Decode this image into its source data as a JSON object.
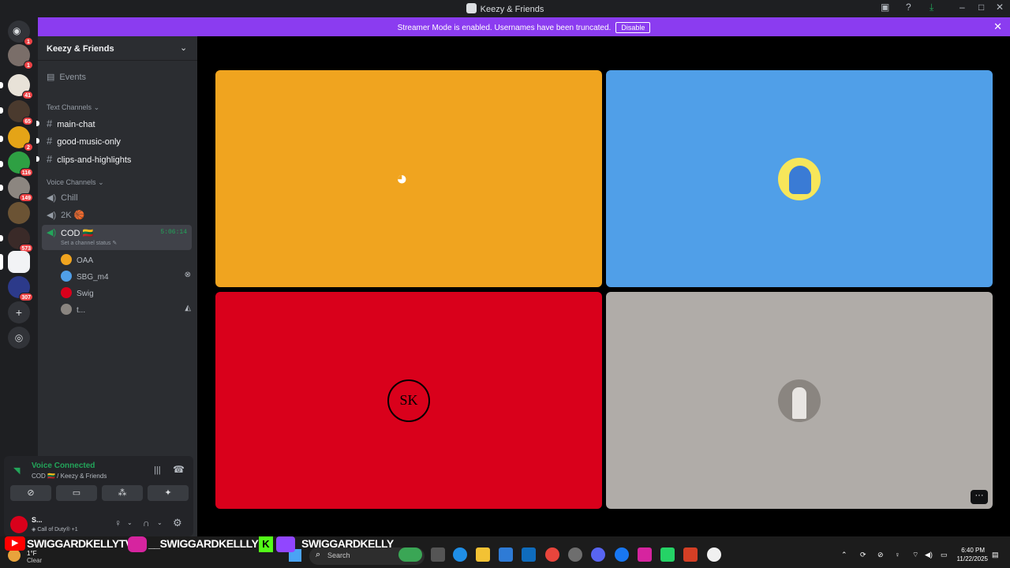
{
  "window": {
    "title": "Keezy & Friends"
  },
  "banner": {
    "text": "Streamer Mode is enabled. Usernames have been truncated.",
    "button": "Disable"
  },
  "guild_badges": [
    "1",
    "1",
    "41",
    "65",
    "2",
    "116",
    "149",
    "573",
    "307"
  ],
  "server": {
    "name": "Keezy & Friends",
    "events_label": "Events",
    "text_category": "Text Channels",
    "text_channels": [
      "main-chat",
      "good-music-only",
      "clips-and-highlights"
    ],
    "voice_category": "Voice Channels",
    "voice_channels": [
      {
        "name": "Chill"
      },
      {
        "name": "2K 🏀"
      },
      {
        "name": "COD 🇱🇹",
        "timer": "5:06:14",
        "status": "Set a channel status"
      }
    ],
    "voice_users": [
      "OAA",
      "SBG_m4",
      "Swig",
      "t..."
    ]
  },
  "panel": {
    "voice_connected": "Voice Connected",
    "location": "COD 🇱🇹 / Keezy & Friends",
    "username": "S...",
    "activity": "Call of Duty® +1"
  },
  "overlay": {
    "youtube": "SWIGGARDKELLYTV",
    "instagram": "__SWIGGARDKELLLY",
    "twitch": "SWIGGARDKELLY"
  },
  "taskbar": {
    "weather_temp": "1°F",
    "weather_desc": "Clear",
    "search": "Search",
    "time": "6:40 PM",
    "date": "11/22/2025"
  },
  "colors": {
    "tile1": "#f0a41f",
    "tile2": "#509fe8",
    "tile3": "#d9001b",
    "tile4": "#b0aca8",
    "banner": "#8b3cf0"
  }
}
